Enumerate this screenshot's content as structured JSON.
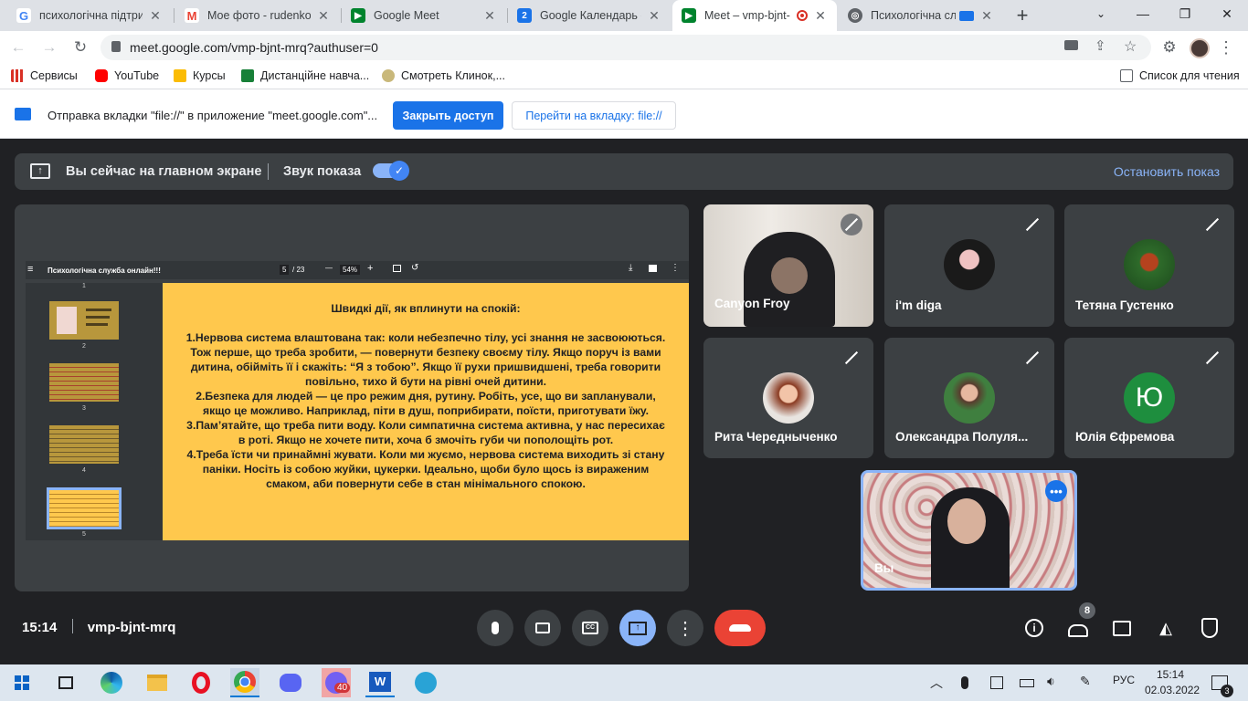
{
  "browser": {
    "tabs": [
      {
        "title": "психологічна підтрим",
        "icon": "google-icon"
      },
      {
        "title": "Мое фото - rudenkov",
        "icon": "gmail-icon"
      },
      {
        "title": "Google Meet",
        "icon": "meet-icon"
      },
      {
        "title": "Google Календарь - с",
        "icon": "calendar-icon"
      },
      {
        "title": "Meet – vmp-bjnt-",
        "icon": "meet-icon",
        "active": true
      },
      {
        "title": "Психологічна слу",
        "icon": "globe-icon"
      }
    ],
    "url": "meet.google.com/vmp-bjnt-mrq?authuser=0",
    "bookmarks": [
      "Сервисы",
      "YouTube",
      "Курсы",
      "Дистанційне навча...",
      "Смотреть Клинок,..."
    ],
    "reading_list": "Список для чтения",
    "infobar": {
      "message": "Отправка вкладки \"file://\" в приложение \"meet.google.com\"...",
      "share_button": "Закрыть доступ",
      "switch_button": "Перейти на вкладку: file://"
    }
  },
  "meet": {
    "presenting_text": "Вы сейчас на главном экране",
    "share_audio_label": "Звук показа",
    "stop_button": "Остановить показ",
    "pdf": {
      "doc_title": "Психологічна служба онлайн!!!",
      "page": "5",
      "page_total": "/ 23",
      "zoom": "54%",
      "thumb_numbers": [
        "1",
        "2",
        "3",
        "4",
        "5"
      ],
      "heading": "Швидкі дії, як вплинути на спокій:",
      "paragraphs": [
        "1.Нервова система влаштована так: коли небезпечно тілу, усі знання не засвоюються. Тож перше, що треба зробити, — повернути безпеку своєму тілу. Якщо поруч із вами дитина, обійміть її і скажіть: “Я з тобою”. Якщо її рухи пришвидшені, треба говорити повільно, тихо й бути на рівні очей дитини.",
        "2.Безпека для людей — це про режим дня, рутину. Робіть, усе, що ви запланували, якщо це можливо. Наприклад, піти в душ, поприбирати, поїсти, приготувати їжу.",
        "3.Пам’ятайте, що треба пити воду. Коли симпатична система активна, у нас пересихає в роті. Якщо не хочете пити, хоча б змочіть губи чи пополощіть рот.",
        "4.Треба їсти чи принаймні жувати. Коли ми жуємо, нервова система виходить зі стану паніки. Носіть із собою жуйки, цукерки. Ідеально, щоби було щось із вираженим смаком, аби повернути себе в стан мінімального спокою."
      ]
    },
    "participants": [
      {
        "name": "Canyon Froy"
      },
      {
        "name": "i'm diga"
      },
      {
        "name": "Тетяна Густенко"
      },
      {
        "name": "Рита Чередныченко"
      },
      {
        "name": "Олександра Полуля..."
      },
      {
        "name": "Юлія Єфремова",
        "initial": "Ю",
        "color": "#1e8e3e"
      },
      {
        "name": "Вы"
      }
    ],
    "time": "15:14",
    "meeting_code": "vmp-bjnt-mrq",
    "people_count": "8"
  },
  "taskbar": {
    "viber_badge": "40",
    "lang": "РУС",
    "time": "15:14",
    "date": "02.03.2022",
    "notif_count": "3"
  }
}
